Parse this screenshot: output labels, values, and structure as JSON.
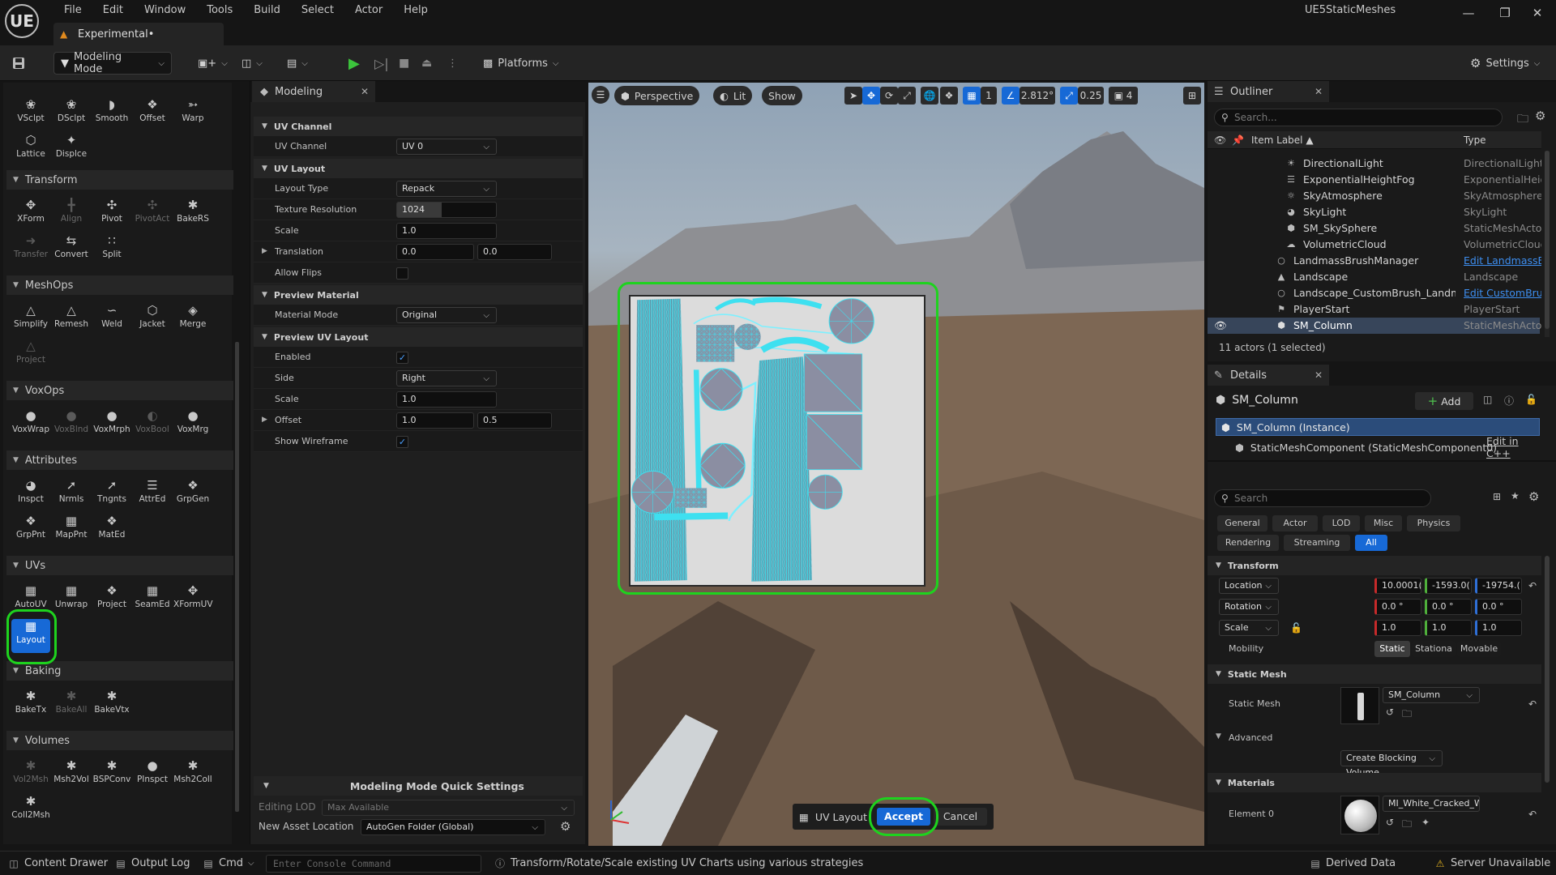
{
  "app": {
    "logo": "UE",
    "menu": [
      "File",
      "Edit",
      "Window",
      "Tools",
      "Build",
      "Select",
      "Actor",
      "Help"
    ],
    "project_tab": "Experimental•",
    "project_name": "UE5StaticMeshes"
  },
  "toolbar": {
    "mode_label": "Modeling Mode",
    "platforms_label": "Platforms",
    "settings_label": "Settings"
  },
  "palette": {
    "sculpt_tools": [
      "VSclpt",
      "DSclpt",
      "Smooth",
      "Offset",
      "Warp",
      "Lattice",
      "Displce"
    ],
    "sections": {
      "transform": "Transform",
      "meshops": "MeshOps",
      "voxops": "VoxOps",
      "attributes": "Attributes",
      "uvs": "UVs",
      "baking": "Baking",
      "volumes": "Volumes"
    },
    "transform_tools": [
      "XForm",
      "Align",
      "Pivot",
      "PivotAct",
      "BakeRS",
      "Transfer",
      "Convert",
      "Split"
    ],
    "meshops_tools": [
      "Simplify",
      "Remesh",
      "Weld",
      "Jacket",
      "Merge",
      "Project"
    ],
    "voxops_tools": [
      "VoxWrap",
      "VoxBlnd",
      "VoxMrph",
      "VoxBool",
      "VoxMrg"
    ],
    "attributes_tools": [
      "Inspct",
      "Nrmls",
      "Tngnts",
      "AttrEd",
      "GrpGen",
      "GrpPnt",
      "MapPnt",
      "MatEd"
    ],
    "uvs_tools": [
      "AutoUV",
      "Unwrap",
      "Project",
      "SeamEd",
      "XFormUV",
      "Layout"
    ],
    "baking_tools": [
      "BakeTx",
      "BakeAll",
      "BakeVtx"
    ],
    "volumes_tools": [
      "Vol2Msh",
      "Msh2Vol",
      "BSPConv",
      "PInspct",
      "Msh2Coll",
      "Coll2Msh"
    ]
  },
  "modeling_panel": {
    "tab_title": "Modeling",
    "groups": {
      "uv_channel": "UV Channel",
      "uv_layout": "UV Layout",
      "preview_material": "Preview Material",
      "preview_uv_layout": "Preview UV Layout"
    },
    "props": {
      "uv_channel_label": "UV Channel",
      "uv_channel_value": "UV 0",
      "layout_type_label": "Layout Type",
      "layout_type_value": "Repack",
      "texture_res_label": "Texture Resolution",
      "texture_res_value": "1024",
      "scale_label": "Scale",
      "scale_value": "1.0",
      "translation_label": "Translation",
      "translation_x": "0.0",
      "translation_y": "0.0",
      "allow_flips_label": "Allow Flips",
      "material_mode_label": "Material Mode",
      "material_mode_value": "Original",
      "enabled_label": "Enabled",
      "side_label": "Side",
      "side_value": "Right",
      "preview_scale_label": "Scale",
      "preview_scale_value": "1.0",
      "offset_label": "Offset",
      "offset_x": "1.0",
      "offset_y": "0.5",
      "show_wireframe_label": "Show Wireframe"
    },
    "quick_settings": {
      "title": "Modeling Mode Quick Settings",
      "editing_lod_label": "Editing LOD",
      "editing_lod_value": "Max Available",
      "new_asset_label": "New Asset Location",
      "new_asset_value": "AutoGen Folder (Global)"
    }
  },
  "viewport": {
    "perspective": "Perspective",
    "lit": "Lit",
    "show": "Show",
    "grid_value": "1",
    "angle_value": "2.812°",
    "scale_value": "0.25",
    "camera_speed": "4",
    "uv_layout_label": "UV Layout",
    "accept_label": "Accept",
    "cancel_label": "Cancel"
  },
  "outliner": {
    "title": "Outliner",
    "search_placeholder": "Search...",
    "col_label": "Item Label ▲",
    "col_type": "Type",
    "rows": [
      {
        "name": "DirectionalLight",
        "type": "DirectionalLight"
      },
      {
        "name": "ExponentialHeightFog",
        "type": "ExponentialHeigl"
      },
      {
        "name": "SkyAtmosphere",
        "type": "SkyAtmosphere"
      },
      {
        "name": "SkyLight",
        "type": "SkyLight"
      },
      {
        "name": "SM_SkySphere",
        "type": "StaticMeshActor"
      },
      {
        "name": "VolumetricCloud",
        "type": "VolumetricCloud"
      },
      {
        "name": "LandmassBrushManager",
        "type": "Edit LandmassB"
      },
      {
        "name": "Landscape",
        "type": "Landscape"
      },
      {
        "name": "Landscape_CustomBrush_Landma:",
        "type": "Edit CustomBrus"
      },
      {
        "name": "PlayerStart",
        "type": "PlayerStart"
      },
      {
        "name": "SM_Column",
        "type": "StaticMeshActor"
      }
    ],
    "summary": "11 actors (1 selected)"
  },
  "details": {
    "title": "Details",
    "actor_name": "SM_Column",
    "add_label": "Add",
    "instance_label": "SM_Column (Instance)",
    "component_label": "StaticMeshComponent (StaticMeshComponent0)",
    "edit_cpp": "Edit in C++",
    "search_placeholder": "Search",
    "filters": [
      "General",
      "Actor",
      "LOD",
      "Misc",
      "Physics",
      "Rendering",
      "Streaming",
      "All"
    ],
    "transform_group": "Transform",
    "location_label": "Location",
    "location": [
      "10.0001(",
      "-1593.0(",
      "-19754.("
    ],
    "rotation_label": "Rotation",
    "rotation": [
      "0.0 °",
      "0.0 °",
      "0.0 °"
    ],
    "scale_label": "Scale",
    "scale": [
      "1.0",
      "1.0",
      "1.0"
    ],
    "mobility_label": "Mobility",
    "mobility": [
      "Static",
      "Stationa",
      "Movable"
    ],
    "static_mesh_group": "Static Mesh",
    "static_mesh_label": "Static Mesh",
    "static_mesh_value": "SM_Column",
    "advanced_label": "Advanced",
    "create_blocking_volume": "Create Blocking Volume",
    "materials_group": "Materials",
    "element0_label": "Element 0",
    "element0_value": "MI_White_Cracked_Wa"
  },
  "statusbar": {
    "content_drawer": "Content Drawer",
    "output_log": "Output Log",
    "cmd": "Cmd",
    "console_placeholder": "Enter Console Command",
    "hint": "Transform/Rotate/Scale existing UV Charts using various strategies",
    "derived_data": "Derived Data",
    "server": "Server Unavailable"
  },
  "colors": {
    "accent_blue": "#1769d6",
    "highlight_green": "#1ed31e",
    "uv_wire_cyan": "#3ee0f0"
  }
}
